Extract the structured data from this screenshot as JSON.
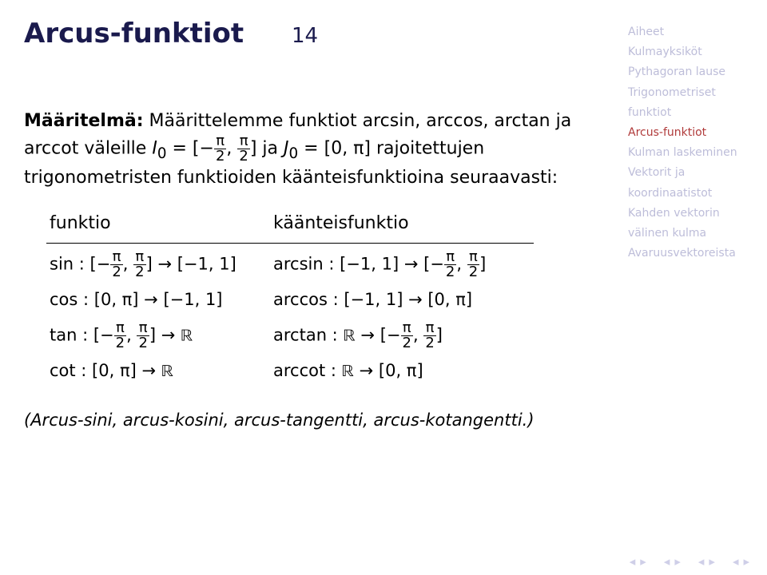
{
  "title": "Arcus-funktiot",
  "page_number": "14",
  "definition": {
    "label": "Määritelmä:",
    "text_before": " Määrittelemme funktiot arcsin, arccos, arctan ja arccot väleille ",
    "I0": "I",
    "I0_sub": "0",
    "eq": " = [−",
    "pi_num": "π",
    "pi_den": "2",
    "comma": ", ",
    "close1": "] ja ",
    "J0": "J",
    "J0_sub": "0",
    "eq2": " = [0, π] rajoitettujen trigonometristen funktioiden käänteisfunktioina seuraavasti:"
  },
  "table": {
    "header_left": "funktio",
    "header_right": "käänteisfunktio",
    "rows": [
      {
        "l_fn": "sin : [−",
        "l_mid": "] → [−1, 1]",
        "r_fn": "arcsin : [−1, 1] → [−",
        "r_mid": "]"
      },
      {
        "l_plain": "cos : [0, π] → [−1, 1]",
        "r_plain": "arccos : [−1, 1] → [0, π]"
      },
      {
        "l_fn": "tan : [−",
        "l_mid": "] → ",
        "l_tail": "ℝ",
        "r_fn": "arctan : ",
        "r_src": "ℝ",
        "r_arrow": " → [−",
        "r_mid": "]"
      },
      {
        "l_plain": "cot : [0, π] → ",
        "l_tail": "ℝ",
        "r_fn": "arccot : ",
        "r_src": "ℝ",
        "r_arrow": " → [0, π]"
      }
    ]
  },
  "note": "(Arcus-sini, arcus-kosini, arcus-tangentti, arcus-kotangentti.)",
  "sidebar": {
    "head": "Aiheet",
    "items": [
      "Kulmayksiköt",
      "Pythagoran lause",
      "Trigonometriset funktiot",
      "Arcus-funktiot",
      "Kulman laskeminen",
      "Vektorit ja koordinaatistot",
      "Kahden vektorin välinen kulma",
      "Avaruusvektoreista"
    ],
    "active_index": 3
  },
  "nav": {
    "a1": "◂",
    "a2": "▸",
    "b1": "◂",
    "b2": "▸",
    "c1": "◂",
    "c2": "▸",
    "d1": "◂",
    "d2": "▸"
  },
  "pi": "π",
  "two": "2"
}
